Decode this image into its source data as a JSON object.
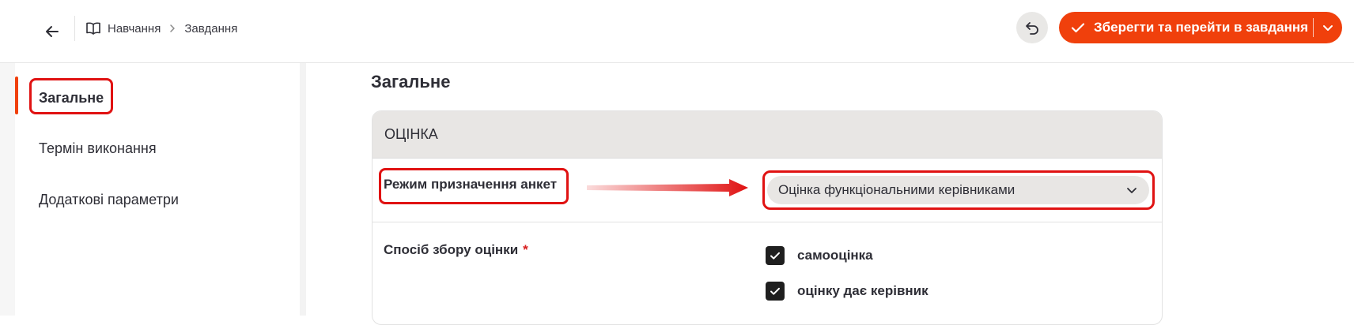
{
  "header": {
    "breadcrumbs": [
      {
        "label": "Навчання"
      },
      {
        "label": "Завдання"
      }
    ],
    "save_button_label": "Зберегти та перейти в завдання"
  },
  "sidebar": {
    "items": [
      {
        "label": "Загальне",
        "active": true
      },
      {
        "label": "Термін виконання"
      },
      {
        "label": "Додаткові параметри"
      }
    ]
  },
  "main": {
    "page_title": "Загальне",
    "section_title": "ОЦІНКА",
    "assignment_mode": {
      "label": "Режим призначення анкет",
      "selected_value": "Оцінка функціональними керівниками"
    },
    "collection_method": {
      "label": "Спосіб збору оцінки",
      "required_mark": "*",
      "options": [
        {
          "label": "самооцінка",
          "checked": true
        },
        {
          "label": "оцінку дає керівник",
          "checked": true
        }
      ]
    }
  },
  "colors": {
    "accent": "#f0400c",
    "highlight": "#e01212"
  }
}
